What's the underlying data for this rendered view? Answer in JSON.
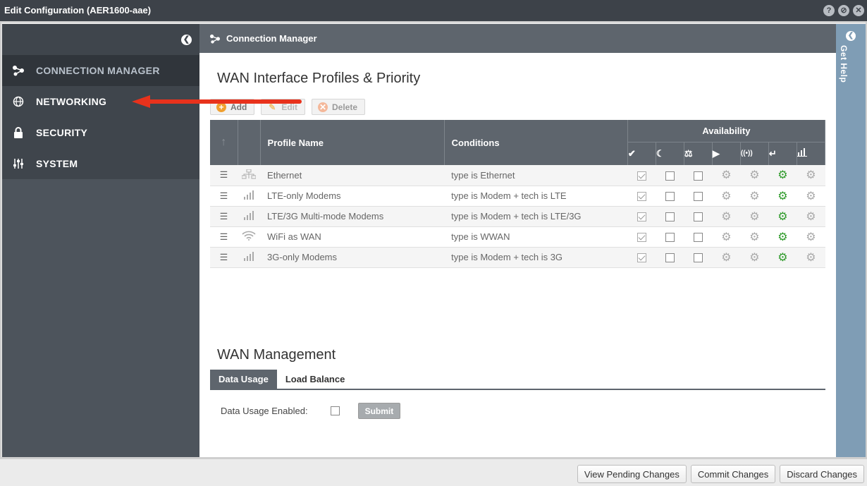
{
  "window": {
    "title": "Edit Configuration (AER1600-aae)"
  },
  "sidebar": {
    "items": [
      {
        "label": "CONNECTION MANAGER",
        "icon": "connection-icon",
        "active": true
      },
      {
        "label": "NETWORKING",
        "icon": "globe-icon",
        "active": false
      },
      {
        "label": "SECURITY",
        "icon": "lock-icon",
        "active": false
      },
      {
        "label": "SYSTEM",
        "icon": "sliders-icon",
        "active": false
      }
    ]
  },
  "main": {
    "header": "Connection Manager",
    "section1_title": "WAN Interface Profiles & Priority",
    "toolbar": {
      "add": "Add",
      "edit": "Edit",
      "delete": "Delete"
    },
    "table": {
      "col_profile": "Profile Name",
      "col_conditions": "Conditions",
      "col_availability": "Availability",
      "rows": [
        {
          "name": "Ethernet",
          "condition": "type is Ethernet",
          "type_icon": "ethernet-icon"
        },
        {
          "name": "LTE-only Modems",
          "condition": "type is Modem + tech is LTE",
          "type_icon": "signal-icon"
        },
        {
          "name": "LTE/3G Multi-mode Modems",
          "condition": "type is Modem + tech is LTE/3G",
          "type_icon": "signal-icon"
        },
        {
          "name": "WiFi as WAN",
          "condition": "type is WWAN",
          "type_icon": "wifi-icon"
        },
        {
          "name": "3G-only Modems",
          "condition": "type is Modem + tech is 3G",
          "type_icon": "signal-icon"
        }
      ]
    },
    "section2_title": "WAN Management",
    "tabs": {
      "data_usage": "Data Usage",
      "load_balance": "Load Balance"
    },
    "data_usage_label": "Data Usage Enabled:",
    "submit": "Submit"
  },
  "help": {
    "label": "Get Help"
  },
  "footer": {
    "view_pending": "View Pending Changes",
    "commit": "Commit Changes",
    "discard": "Discard Changes"
  },
  "colors": {
    "accent_green": "#2e9a2a",
    "header_gray": "#5e656d",
    "arrow_red": "#e8321c",
    "help_blue": "#7f9db5"
  }
}
